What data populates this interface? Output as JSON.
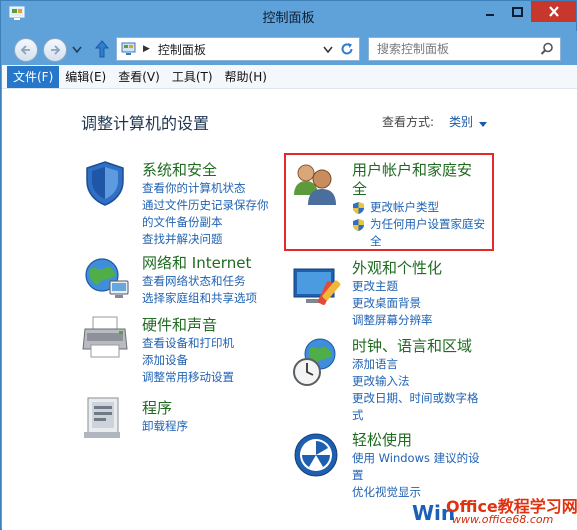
{
  "window": {
    "title": "控制面板"
  },
  "nav": {
    "address_path": "控制面板",
    "search_placeholder": "搜索控制面板"
  },
  "menu": [
    "文件(F)",
    "编辑(E)",
    "查看(V)",
    "工具(T)",
    "帮助(H)"
  ],
  "main": {
    "heading": "调整计算机的设置",
    "view_by_label": "查看方式:",
    "view_by_value": "类别"
  },
  "categories": {
    "system": {
      "title": "系统和安全",
      "links": [
        "查看你的计算机状态",
        "通过文件历史记录保存你",
        "的文件备份副本",
        "查找并解决问题"
      ]
    },
    "network": {
      "title": "网络和 Internet",
      "links": [
        "查看网络状态和任务",
        "选择家庭组和共享选项"
      ]
    },
    "hardware": {
      "title": "硬件和声音",
      "links": [
        "查看设备和打印机",
        "添加设备",
        "调整常用移动设置"
      ]
    },
    "programs": {
      "title": "程序",
      "links": [
        "卸载程序"
      ]
    },
    "users": {
      "title_line1": "用户帐户和家庭安",
      "title_line2": "全",
      "links": [
        "更改帐户类型",
        "为任何用户设置家庭安",
        "全"
      ]
    },
    "appearance": {
      "title": "外观和个性化",
      "links": [
        "更改主题",
        "更改桌面背景",
        "调整屏幕分辨率"
      ]
    },
    "clock": {
      "title": "时钟、语言和区域",
      "links": [
        "添加语言",
        "更改输入法",
        "更改日期、时间或数字格",
        "式"
      ]
    },
    "ease": {
      "title": "轻松使用",
      "links": [
        "使用 Windows 建议的设",
        "置",
        "优化视觉显示"
      ]
    }
  },
  "watermark": {
    "win": "Win",
    "brand": "Office教程学习网",
    "url": "www.office68.com"
  },
  "colors": {
    "frame": "#5fa2d9",
    "category_title": "#1f6b20",
    "link": "#2163b3",
    "highlight_box": "#e22a2a",
    "close_button": "#c7372b"
  }
}
